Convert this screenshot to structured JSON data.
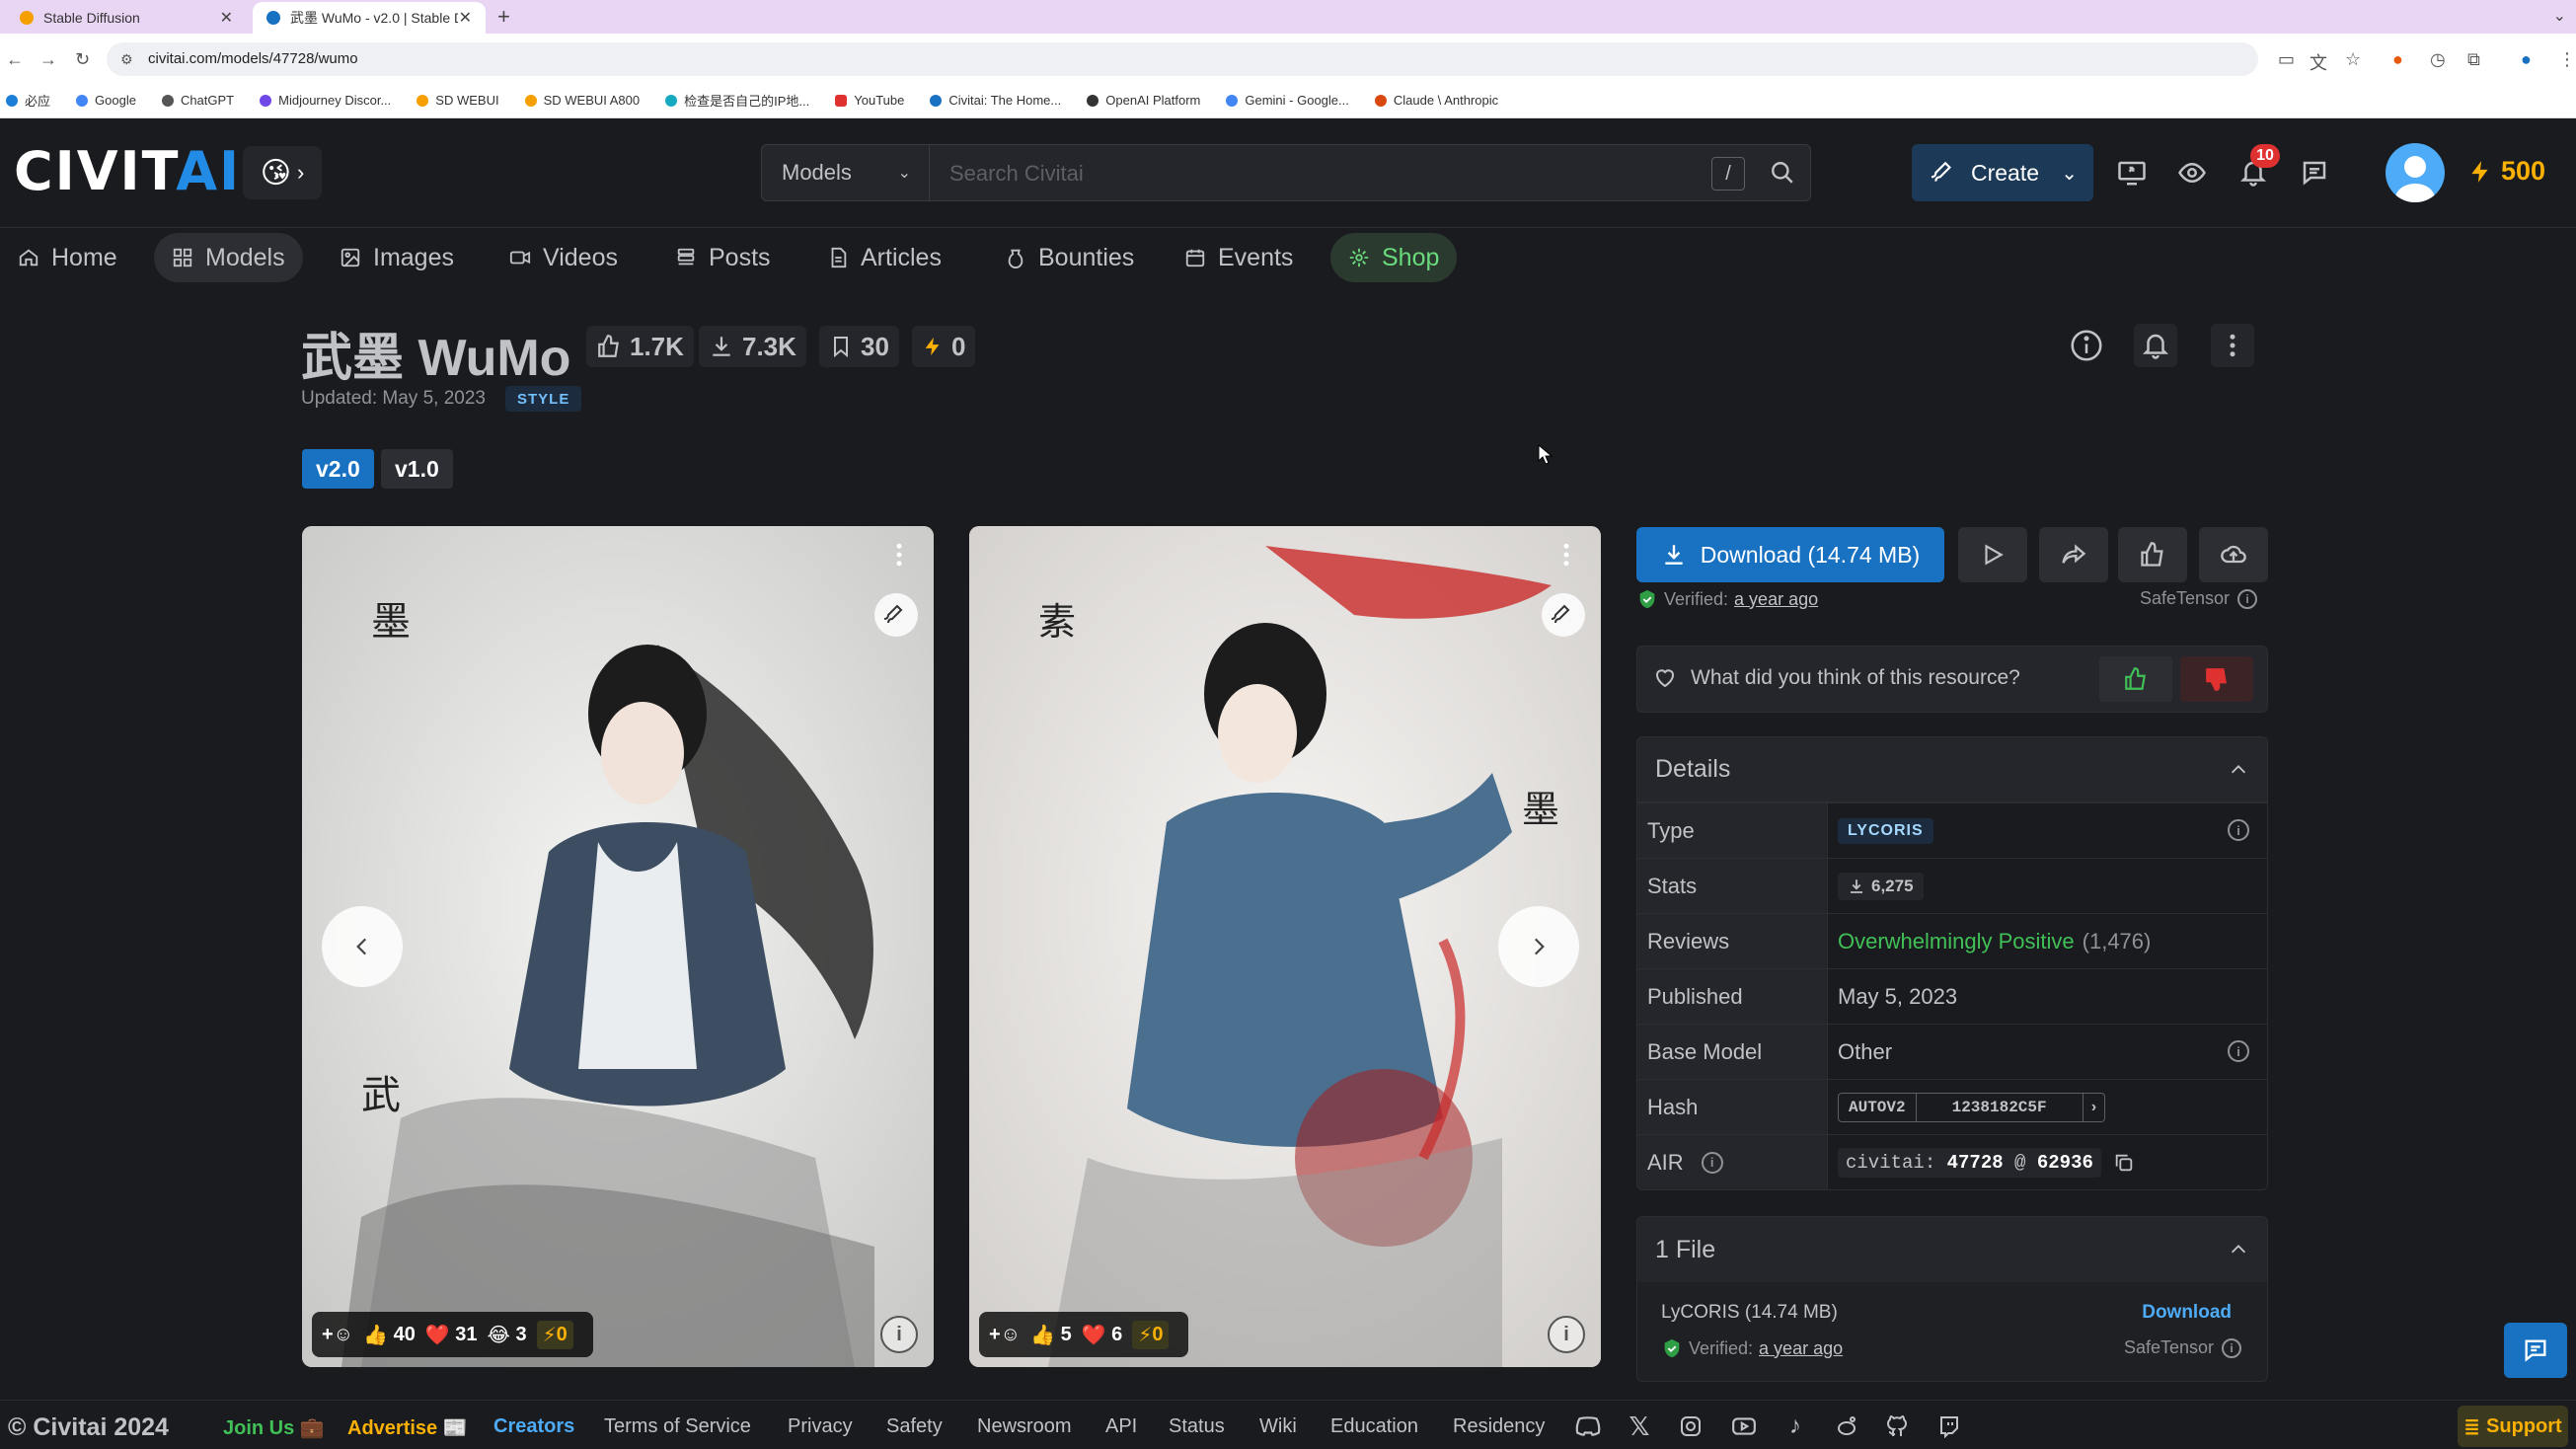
{
  "browser": {
    "tabs": [
      {
        "title": "Stable Diffusion",
        "active": false
      },
      {
        "title": "武墨 WuMo - v2.0 | Stable Di...",
        "active": true
      }
    ],
    "new_tab": "+",
    "url": "civitai.com/models/47728/wumo",
    "bookmarks": [
      "必应",
      "Google",
      "ChatGPT",
      "Midjourney Discor...",
      "SD WEBUI",
      "SD WEBUI A800",
      "检查是否自己的IP地...",
      "YouTube",
      "Civitai: The Home...",
      "OpenAI Platform",
      "Gemini - Google...",
      "Claude \\ Anthropic"
    ]
  },
  "header": {
    "logo_main": "CIVIT",
    "logo_accent": "AI",
    "emoji": "😘",
    "search_type": "Models",
    "search_placeholder": "Search Civitai",
    "search_shortcut": "/",
    "create_label": "Create",
    "notifications_count": "10",
    "buzz": "500"
  },
  "nav": {
    "items": [
      {
        "label": "Home",
        "icon": "home-icon"
      },
      {
        "label": "Models",
        "icon": "grid-icon"
      },
      {
        "label": "Images",
        "icon": "image-icon"
      },
      {
        "label": "Videos",
        "icon": "video-icon"
      },
      {
        "label": "Posts",
        "icon": "posts-icon"
      },
      {
        "label": "Articles",
        "icon": "article-icon"
      },
      {
        "label": "Bounties",
        "icon": "bounty-icon"
      },
      {
        "label": "Events",
        "icon": "calendar-icon"
      },
      {
        "label": "Shop",
        "icon": "shop-icon"
      }
    ],
    "active": "Models"
  },
  "model": {
    "title": "武墨 WuMo",
    "likes": "1.7K",
    "downloads": "7.3K",
    "bookmarks": "30",
    "buzz": "0",
    "updated": "Updated: May 5, 2023",
    "tag": "STYLE",
    "versions": [
      "v2.0",
      "v1.0"
    ]
  },
  "gallery": [
    {
      "reactions": {
        "like": "40",
        "heart": "31",
        "laugh": "3",
        "buzz": "0"
      }
    },
    {
      "reactions": {
        "like": "5",
        "heart": "6",
        "buzz": "0"
      }
    }
  ],
  "actions": {
    "download_label": "Download (14.74 MB)",
    "verified_label": "Verified:",
    "verified_time": "a year ago",
    "safetensor": "SafeTensor",
    "feedback_question": "What did you think of this resource?"
  },
  "details": {
    "heading": "Details",
    "rows": {
      "type_label": "Type",
      "type_value": "LYCORIS",
      "stats_label": "Stats",
      "stats_value": "6,275",
      "reviews_label": "Reviews",
      "reviews_value": "Overwhelmingly Positive",
      "reviews_count": "(1,476)",
      "published_label": "Published",
      "published_value": "May 5, 2023",
      "base_label": "Base Model",
      "base_value": "Other",
      "hash_label": "Hash",
      "hash_type": "AUTOV2",
      "hash_value": "1238182C5F",
      "air_label": "AIR",
      "air_prefix": "civitai:",
      "air_model": "47728",
      "air_at": "@",
      "air_version": "62936"
    }
  },
  "files": {
    "heading": "1 File",
    "name": "LyCORIS (14.74 MB)",
    "download": "Download",
    "verified_label": "Verified:",
    "verified_time": "a year ago",
    "safetensor": "SafeTensor"
  },
  "footer": {
    "copyright": "© Civitai 2024",
    "join": "Join Us 💼",
    "advertise": "Advertise 📰",
    "links": [
      "Creators",
      "Terms of Service",
      "Privacy",
      "Safety",
      "Newsroom",
      "API",
      "Status",
      "Wiki",
      "Education",
      "Residency"
    ],
    "support": "Support"
  },
  "colors": {
    "bg": "#1a1b1e",
    "accent_blue": "#1971c2",
    "green": "#40c057",
    "buzz_yellow": "#fab005"
  }
}
